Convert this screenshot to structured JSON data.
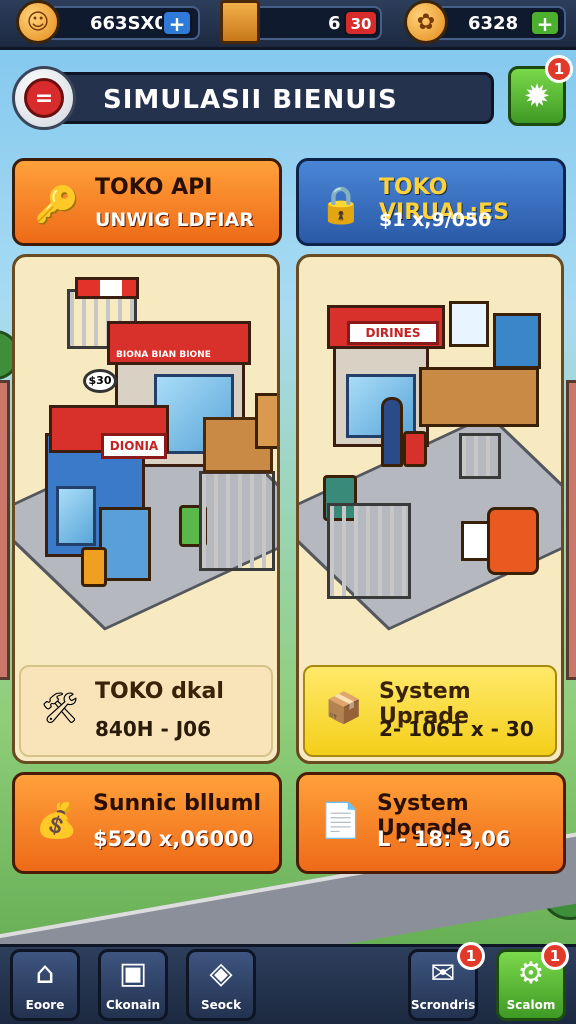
{
  "topbar": {
    "coins_value": "663SX0",
    "crates_value": "6",
    "crates_badge": "30",
    "gold_value": "6328",
    "plus_label": "+"
  },
  "header": {
    "title": "SIMULASII BIENUIS",
    "settings_badge": "1"
  },
  "tabs": [
    {
      "title": "TOKO API",
      "subtitle": "UNWIG LDFIAR"
    },
    {
      "title": "TOKO VIRUAL:ES",
      "subtitle": "$1 x,9/050"
    }
  ],
  "panels": [
    {
      "store_sign": "DIONIA",
      "awning_text": "BIONA  BIAN  BIONE",
      "price_tag": "$30",
      "info_title": "TOKO dkal",
      "info_value": "840H - J06"
    },
    {
      "store_sign": "DIRINES",
      "info_title": "System Uprade",
      "info_value": "2- 1061 x - 30"
    }
  ],
  "actions": [
    {
      "title": "Sunnic blluml",
      "value": "$520 x,06000"
    },
    {
      "title": "System Upgade",
      "value": "L - 18: 3,06"
    }
  ],
  "bottom_nav": {
    "home": "Eoore",
    "shop": "Ckonain",
    "stock": "Seock",
    "stats": "Scrondris",
    "settings": "Scalom",
    "stats_badge": "1",
    "settings_badge": "1"
  },
  "colors": {
    "accent_orange": "#f07a1e",
    "accent_blue": "#2f64b4",
    "accent_green": "#4cb02e",
    "bar_dark": "#24324d"
  }
}
